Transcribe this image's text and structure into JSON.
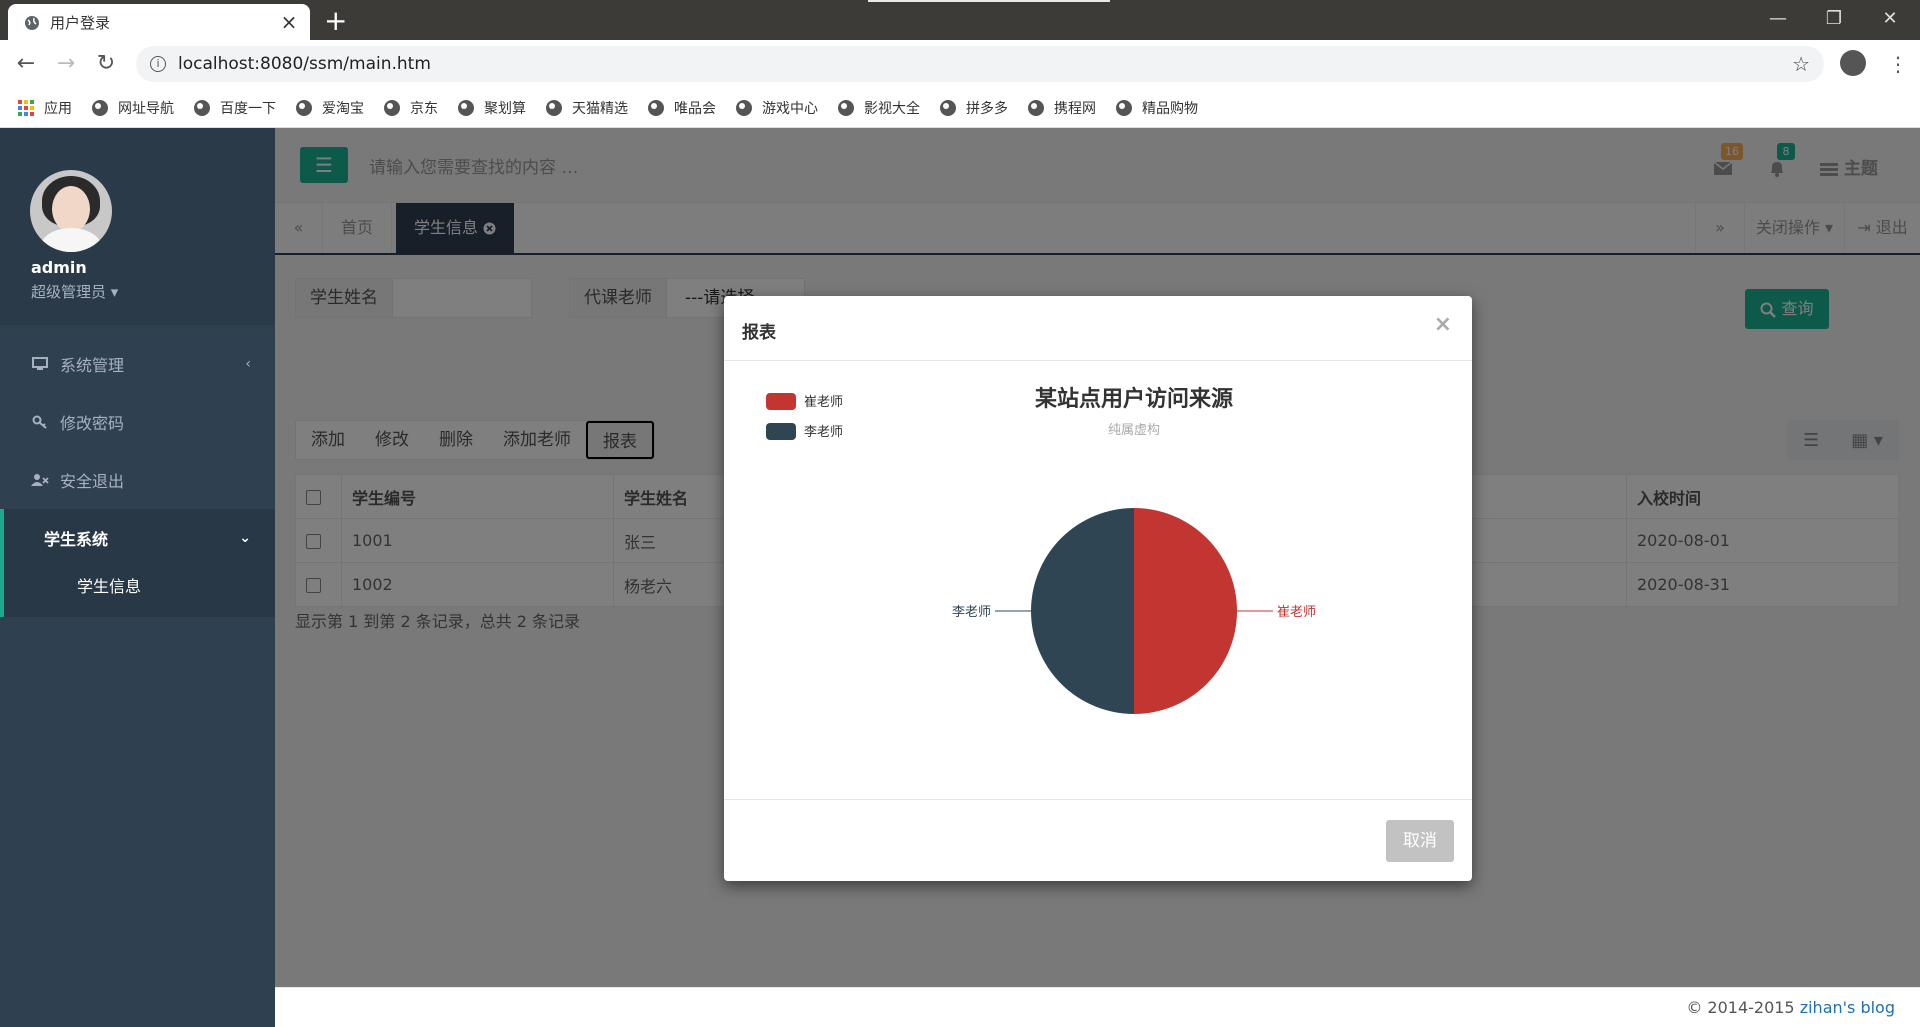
{
  "browser": {
    "tab_title": "用户登录",
    "url": "localhost:8080/ssm/main.htm",
    "bookmarks": [
      "应用",
      "网址导航",
      "百度一下",
      "爱淘宝",
      "京东",
      "聚划算",
      "天猫精选",
      "唯品会",
      "游戏中心",
      "影视大全",
      "拼多多",
      "携程网",
      "精品购物"
    ]
  },
  "sidebar": {
    "username": "admin",
    "role": "超级管理员",
    "items": [
      {
        "label": "系统管理",
        "icon": "monitor-icon"
      },
      {
        "label": "修改密码",
        "icon": "key-icon"
      },
      {
        "label": "安全退出",
        "icon": "user-x-icon"
      }
    ],
    "active_group": "学生系统",
    "active_sub": "学生信息"
  },
  "topnav": {
    "search_placeholder": "请输入您需要查找的内容 …",
    "mail_count": "16",
    "bell_count": "8",
    "theme_label": "主题",
    "mail_badge_color": "#f8ac59",
    "bell_badge_color": "#1ab394"
  },
  "tabs": {
    "home": "首页",
    "current": "学生信息",
    "close_ops": "关闭操作",
    "logout": "退出"
  },
  "filters": {
    "name_label": "学生姓名",
    "teacher_label": "代课老师",
    "teacher_select": "---请选择---",
    "query_button": "查询"
  },
  "toolbar": {
    "add": "添加",
    "edit": "修改",
    "delete": "删除",
    "add_teacher": "添加老师",
    "report": "报表"
  },
  "table": {
    "headers": [
      "学生编号",
      "学生姓名",
      "入校时间"
    ],
    "rows": [
      [
        "1001",
        "张三",
        "2020-08-01"
      ],
      [
        "1002",
        "杨老六",
        "2020-08-31"
      ]
    ],
    "record_info": "显示第 1 到第 2 条记录，总共 2 条记录"
  },
  "footer": {
    "copyright": "© 2014-2015 ",
    "link": "zihan's blog"
  },
  "modal": {
    "title": "报表",
    "close_symbol": "×",
    "cancel": "取消"
  },
  "chart_data": {
    "type": "pie",
    "title": "某站点用户访问来源",
    "subtitle": "纯属虚构",
    "legend_position": "top-left",
    "series": [
      {
        "name": "崔老师",
        "value": 1,
        "color": "#c23531"
      },
      {
        "name": "李老师",
        "value": 1,
        "color": "#2f4554"
      }
    ]
  }
}
